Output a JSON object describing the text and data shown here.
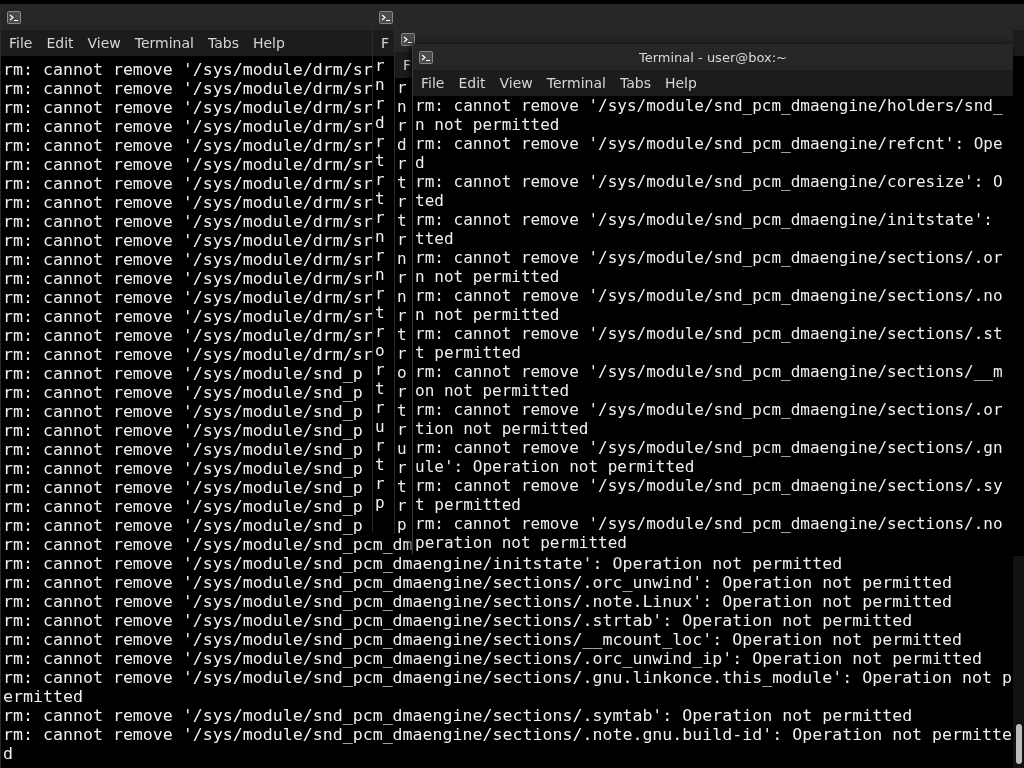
{
  "windows": [
    {
      "kind": "back",
      "menu": [
        "File",
        "Edit",
        "View",
        "Terminal",
        "Tabs",
        "Help"
      ],
      "lines": [
        "rm: cannot remove '/sys/module/drm/sr",
        "rm: cannot remove '/sys/module/drm/sr",
        "rm: cannot remove '/sys/module/drm/sr",
        "rm: cannot remove '/sys/module/drm/sr",
        "rm: cannot remove '/sys/module/drm/sr",
        "rm: cannot remove '/sys/module/drm/sr",
        "rm: cannot remove '/sys/module/drm/sr",
        "rm: cannot remove '/sys/module/drm/sr",
        "rm: cannot remove '/sys/module/drm/sr",
        "rm: cannot remove '/sys/module/drm/sr",
        "rm: cannot remove '/sys/module/drm/sr",
        "rm: cannot remove '/sys/module/drm/sr",
        "rm: cannot remove '/sys/module/drm/sr",
        "rm: cannot remove '/sys/module/drm/sr",
        "rm: cannot remove '/sys/module/drm/sr",
        "rm: cannot remove '/sys/module/drm/sr",
        "rm: cannot remove '/sys/module/snd_p",
        "rm: cannot remove '/sys/module/snd_p",
        "rm: cannot remove '/sys/module/snd_p",
        "rm: cannot remove '/sys/module/snd_p",
        "rm: cannot remove '/sys/module/snd_p",
        "rm: cannot remove '/sys/module/snd_p",
        "rm: cannot remove '/sys/module/snd_p",
        "rm: cannot remove '/sys/module/snd_p",
        "rm: cannot remove '/sys/module/snd_p",
        "rm: cannot remove '/sys/module/snd_pcm_dm",
        "rm: cannot remove '/sys/module/snd_pcm_dmaengine/initstate': Operation not permitted",
        "rm: cannot remove '/sys/module/snd_pcm_dmaengine/sections/.orc_unwind': Operation not permitted",
        "rm: cannot remove '/sys/module/snd_pcm_dmaengine/sections/.note.Linux': Operation not permitted",
        "rm: cannot remove '/sys/module/snd_pcm_dmaengine/sections/.strtab': Operation not permitted",
        "rm: cannot remove '/sys/module/snd_pcm_dmaengine/sections/__mcount_loc': Operation not permitted",
        "rm: cannot remove '/sys/module/snd_pcm_dmaengine/sections/.orc_unwind_ip': Operation not permitted",
        "rm: cannot remove '/sys/module/snd_pcm_dmaengine/sections/.gnu.linkonce.this_module': Operation not p",
        "ermitted",
        "rm: cannot remove '/sys/module/snd_pcm_dmaengine/sections/.symtab': Operation not permitted",
        "rm: cannot remove '/sys/module/snd_pcm_dmaengine/sections/.note.gnu.build-id': Operation not permitte",
        "d"
      ]
    },
    {
      "kind": "stacked",
      "menu": [
        "F"
      ],
      "lines": [
        "r",
        "n",
        "r",
        "d",
        "r",
        "t",
        "r",
        "t",
        "r",
        "n",
        "r",
        "n",
        "r",
        "t",
        "r",
        "o",
        "r",
        "t",
        "r",
        "u",
        "r",
        "t",
        "r",
        "p"
      ]
    },
    {
      "kind": "stacked",
      "menu": [
        "F"
      ],
      "lines": [
        "r",
        "n",
        "r",
        "d",
        "r",
        "t",
        "r",
        "t",
        "r",
        "n",
        "r",
        "n",
        "r",
        "t",
        "r",
        "o",
        "r",
        "t",
        "r",
        "u",
        "r",
        "t",
        "r",
        "p"
      ]
    },
    {
      "kind": "front",
      "title": "Terminal - user@box:~",
      "menu": [
        "File",
        "Edit",
        "View",
        "Terminal",
        "Tabs",
        "Help"
      ],
      "lines": [
        "rm: cannot remove '/sys/module/snd_pcm_dmaengine/holders/snd_",
        "n not permitted",
        "rm: cannot remove '/sys/module/snd_pcm_dmaengine/refcnt': Ope",
        "d",
        "rm: cannot remove '/sys/module/snd_pcm_dmaengine/coresize': O",
        "ted",
        "rm: cannot remove '/sys/module/snd_pcm_dmaengine/initstate':",
        "tted",
        "rm: cannot remove '/sys/module/snd_pcm_dmaengine/sections/.or",
        "n not permitted",
        "rm: cannot remove '/sys/module/snd_pcm_dmaengine/sections/.no",
        "n not permitted",
        "rm: cannot remove '/sys/module/snd_pcm_dmaengine/sections/.st",
        "t permitted",
        "rm: cannot remove '/sys/module/snd_pcm_dmaengine/sections/__m",
        "on not permitted",
        "rm: cannot remove '/sys/module/snd_pcm_dmaengine/sections/.or",
        "tion not permitted",
        "rm: cannot remove '/sys/module/snd_pcm_dmaengine/sections/.gn",
        "ule': Operation not permitted",
        "rm: cannot remove '/sys/module/snd_pcm_dmaengine/sections/.sy",
        "t permitted",
        "rm: cannot remove '/sys/module/snd_pcm_dmaengine/sections/.no",
        "peration not permitted"
      ]
    }
  ]
}
